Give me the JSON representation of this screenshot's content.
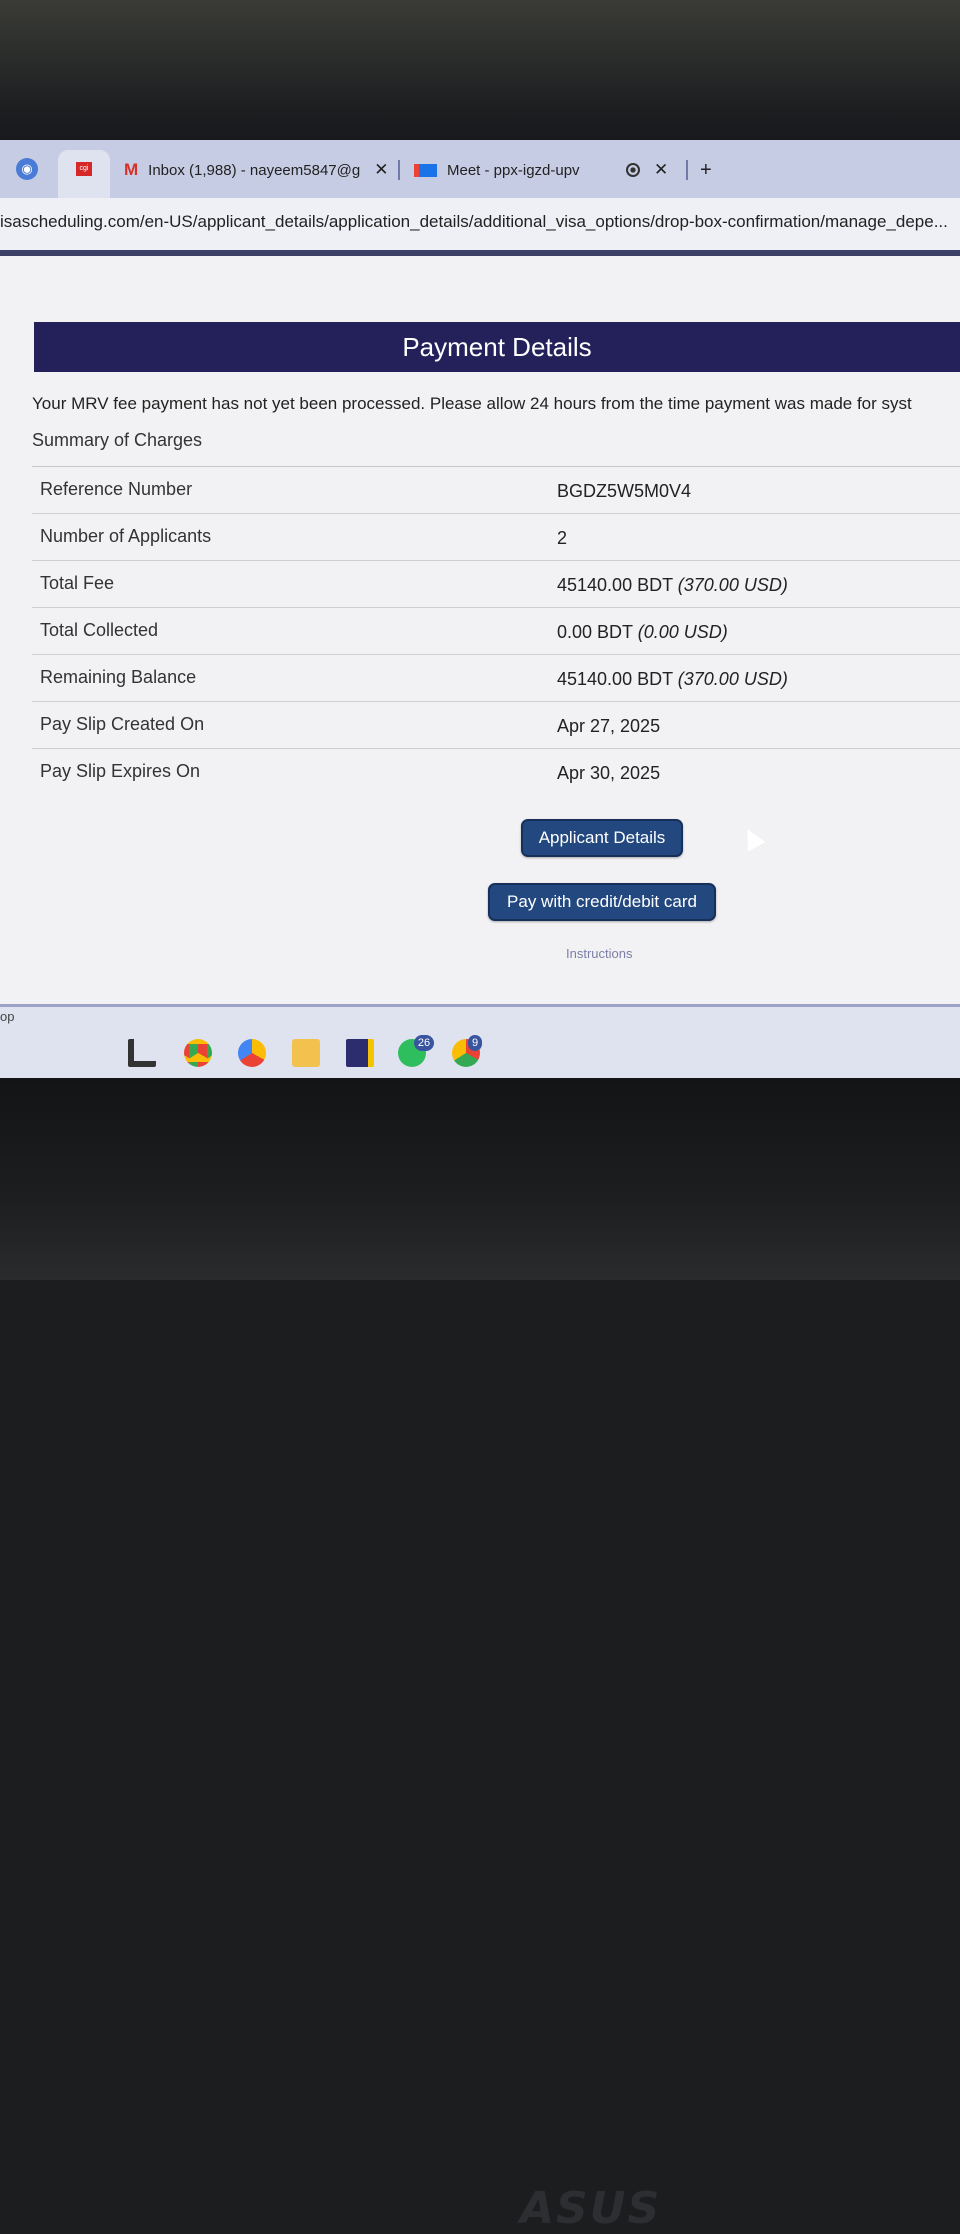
{
  "browser": {
    "tabs": [
      {
        "label": "Inbox (1,988) - nayeem5847@g",
        "icon": "gmail-icon"
      },
      {
        "label": "Meet - ppx-igzd-upv",
        "icon": "meet-icon"
      }
    ],
    "url": "isascheduling.com/en-US/applicant_details/application_details/additional_visa_options/drop-box-confirmation/manage_depe..."
  },
  "page": {
    "title": "Payment Details",
    "notice": "Your MRV fee payment has not yet been processed. Please allow 24 hours from the time payment was made for syst",
    "summary_title": "Summary of Charges",
    "charges": [
      {
        "label": "Reference Number",
        "value": "BGDZ5W5M0V4",
        "usd": ""
      },
      {
        "label": "Number of Applicants",
        "value": "2",
        "usd": ""
      },
      {
        "label": "Total Fee",
        "value": "45140.00 BDT",
        "usd": "(370.00 USD)"
      },
      {
        "label": "Total Collected",
        "value": "0.00 BDT",
        "usd": "(0.00 USD)"
      },
      {
        "label": "Remaining Balance",
        "value": "45140.00 BDT",
        "usd": "(370.00 USD)"
      },
      {
        "label": "Pay Slip Created On",
        "value": "Apr 27, 2025",
        "usd": ""
      },
      {
        "label": "Pay Slip Expires On",
        "value": "Apr 30, 2025",
        "usd": ""
      }
    ],
    "applicant_button": "Applicant Details",
    "pay_button": "Pay with credit/debit card",
    "instructions_link": "Instructions"
  },
  "taskbar": {
    "edge_text": "op",
    "whatsapp_badge": "26",
    "chrome_badge": "9"
  },
  "hardware": {
    "brand": "ASUS"
  },
  "colors": {
    "header": "#24215a",
    "button": "#23487f"
  }
}
